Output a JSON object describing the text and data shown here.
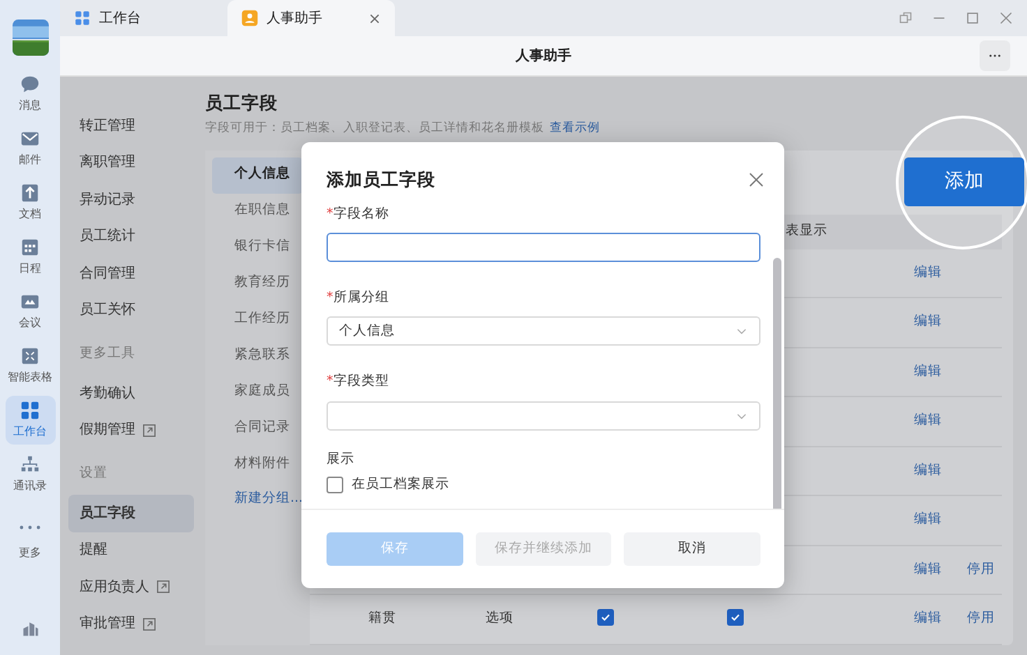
{
  "tabs": [
    {
      "label": "工作台",
      "kind": "grid",
      "selected": false
    },
    {
      "label": "人事助手",
      "kind": "person",
      "selected": true,
      "closable": true
    }
  ],
  "app_header": {
    "title": "人事助手"
  },
  "rail": {
    "items": [
      {
        "label": "消息",
        "kind": "chat",
        "selected": false
      },
      {
        "label": "邮件",
        "kind": "mail",
        "selected": false
      },
      {
        "label": "文档",
        "kind": "doc",
        "selected": false
      },
      {
        "label": "日程",
        "kind": "calendar",
        "selected": false
      },
      {
        "label": "会议",
        "kind": "meeting",
        "selected": false
      },
      {
        "label": "智能表格",
        "kind": "sheet",
        "selected": false
      },
      {
        "label": "工作台",
        "kind": "grid",
        "selected": true
      },
      {
        "label": "通讯录",
        "kind": "org",
        "selected": false
      },
      {
        "label": "更多",
        "kind": "more",
        "selected": false
      }
    ]
  },
  "nav": {
    "items": [
      {
        "kind": "item",
        "label": "转正管理",
        "selected": false,
        "external": false
      },
      {
        "kind": "item",
        "label": "离职管理",
        "selected": false,
        "external": false
      },
      {
        "kind": "item",
        "label": "异动记录",
        "selected": false,
        "external": false
      },
      {
        "kind": "item",
        "label": "员工统计",
        "selected": false,
        "external": false
      },
      {
        "kind": "item",
        "label": "合同管理",
        "selected": false,
        "external": false
      },
      {
        "kind": "item",
        "label": "员工关怀",
        "selected": false,
        "external": false
      },
      {
        "kind": "section",
        "label": "更多工具"
      },
      {
        "kind": "item",
        "label": "考勤确认",
        "selected": false,
        "external": false
      },
      {
        "kind": "item",
        "label": "假期管理",
        "selected": false,
        "external": true
      },
      {
        "kind": "section",
        "label": "设置"
      },
      {
        "kind": "item",
        "label": "员工字段",
        "selected": true,
        "external": false
      },
      {
        "kind": "item",
        "label": "提醒",
        "selected": false,
        "external": false
      },
      {
        "kind": "item",
        "label": "应用负责人",
        "selected": false,
        "external": true
      },
      {
        "kind": "item",
        "label": "审批管理",
        "selected": false,
        "external": true
      }
    ]
  },
  "page": {
    "title": "员工字段",
    "description": "字段可用于：员工档案、入职登记表、员工详情和花名册模板",
    "example_link": "查看示例"
  },
  "groups": {
    "items": [
      {
        "label": "个人信息",
        "selected": true
      },
      {
        "label": "在职信息",
        "selected": false
      },
      {
        "label": "银行卡信",
        "selected": false
      },
      {
        "label": "教育经历",
        "selected": false
      },
      {
        "label": "工作经历",
        "selected": false
      },
      {
        "label": "紧急联系",
        "selected": false
      },
      {
        "label": "家庭成员",
        "selected": false
      },
      {
        "label": "合同记录",
        "selected": false
      },
      {
        "label": "材料附件",
        "selected": false
      }
    ],
    "new_group": "新建分组..."
  },
  "add_button": {
    "label": "添加",
    "highlighted": true
  },
  "table": {
    "columns": [
      "表显示"
    ],
    "rows": [
      {
        "actions": [
          "编辑"
        ]
      },
      {
        "actions": [
          "编辑"
        ]
      },
      {
        "actions": [
          "编辑"
        ]
      },
      {
        "actions": [
          "编辑"
        ]
      },
      {
        "actions": [
          "编辑"
        ]
      },
      {
        "actions": [
          "编辑"
        ]
      },
      {
        "actions": [
          "编辑",
          "停用"
        ]
      },
      {
        "name": "籍贯",
        "type": "选项",
        "show_a": true,
        "show_b": true,
        "actions": [
          "编辑",
          "停用"
        ]
      }
    ]
  },
  "dialog": {
    "title": "添加员工字段",
    "fields": [
      {
        "kind": "input",
        "label": "字段名称",
        "required_mark": "*",
        "focused": true
      },
      {
        "kind": "select",
        "label": "所属分组",
        "required_mark": "*",
        "value": "个人信息"
      },
      {
        "kind": "select",
        "label": "字段类型",
        "required_mark": "*"
      }
    ],
    "display": {
      "label": "展示",
      "options": [
        {
          "label": "在员工档案展示",
          "checked": false
        }
      ]
    },
    "buttons": [
      {
        "label": "保存",
        "kind": "primary",
        "disabled": true
      },
      {
        "label": "保存并继续添加",
        "kind": "secondary",
        "disabled": true
      },
      {
        "label": "取消",
        "kind": "secondary",
        "disabled": false
      }
    ]
  }
}
